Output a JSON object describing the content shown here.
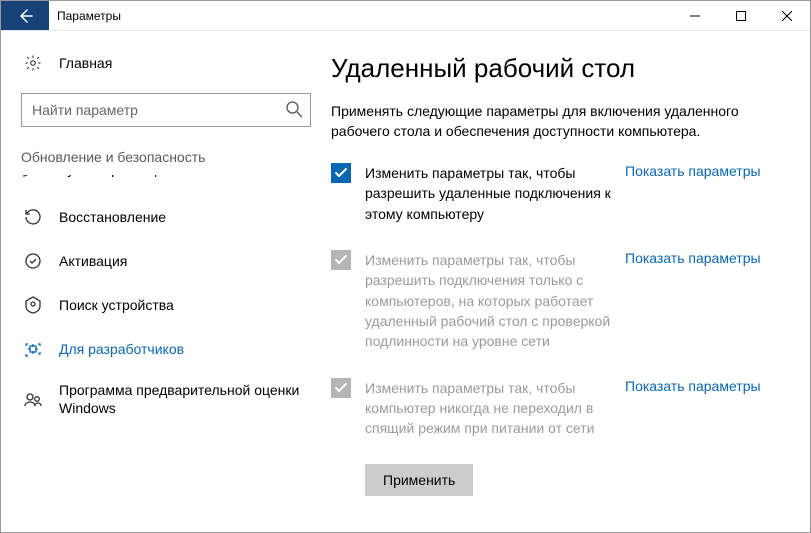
{
  "window": {
    "title": "Параметры"
  },
  "sidebar": {
    "home": "Главная",
    "search_placeholder": "Найти параметр",
    "category": "Обновление и безопасность",
    "cutoff": "Служба архивации",
    "items": [
      {
        "label": "Восстановление"
      },
      {
        "label": "Активация"
      },
      {
        "label": "Поиск устройства"
      },
      {
        "label": "Для разработчиков"
      },
      {
        "label": "Программа предварительной оценки Windows"
      }
    ]
  },
  "content": {
    "heading": "Удаленный рабочий стол",
    "subtitle": "Применять следующие параметры для включения удаленного рабочего стола и обеспечения доступности компьютера.",
    "settings": [
      {
        "checked": true,
        "disabled": false,
        "text": "Изменить параметры так, чтобы разрешить удаленные подключения к этому компьютеру",
        "link": "Показать параметры"
      },
      {
        "checked": true,
        "disabled": true,
        "text": "Изменить параметры так, чтобы разрешить подключения только с компьютеров, на которых работает удаленный рабочий стол с проверкой подлинности на уровне сети",
        "link": "Показать параметры"
      },
      {
        "checked": true,
        "disabled": true,
        "text": "Изменить параметры так, чтобы компьютер никогда не переходил в спящий режим при питании от сети",
        "link": "Показать параметры"
      }
    ],
    "apply": "Применить"
  }
}
